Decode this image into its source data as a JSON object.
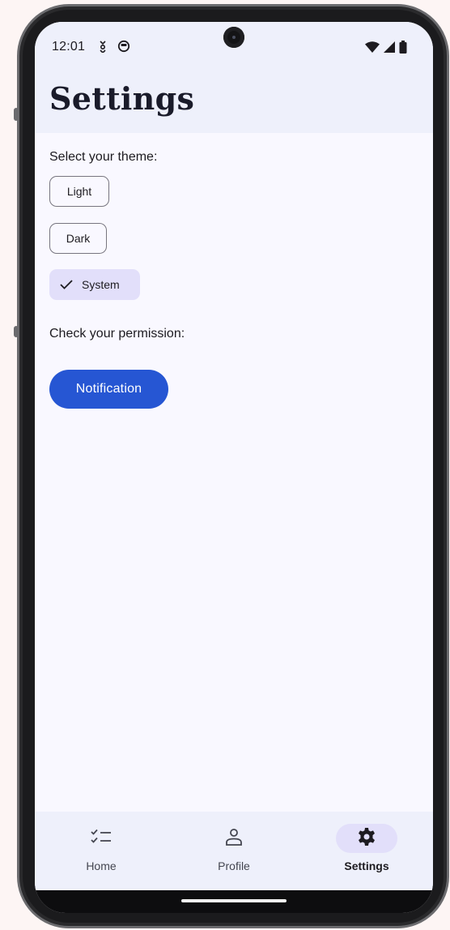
{
  "status_bar": {
    "time": "12:01",
    "left_icons": [
      "usb-debug-icon",
      "app-status-icon"
    ],
    "right_icons": [
      "wifi-icon",
      "signal-icon",
      "battery-icon"
    ]
  },
  "header": {
    "title": "Settings"
  },
  "theme_section": {
    "label": "Select your theme:",
    "options": [
      {
        "label": "Light",
        "selected": false
      },
      {
        "label": "Dark",
        "selected": false
      },
      {
        "label": "System",
        "selected": true
      }
    ]
  },
  "permission_section": {
    "label": "Check your permission:",
    "button_label": "Notification"
  },
  "bottom_nav": {
    "items": [
      {
        "label": "Home",
        "icon": "checklist-icon",
        "active": false
      },
      {
        "label": "Profile",
        "icon": "person-icon",
        "active": false
      },
      {
        "label": "Settings",
        "icon": "gear-icon",
        "active": true
      }
    ]
  },
  "colors": {
    "primary": "#2656d3",
    "surface": "#f9f8ff",
    "surface_container": "#eef0fb",
    "secondary_container": "#e2dffa",
    "outline": "#77757f"
  }
}
